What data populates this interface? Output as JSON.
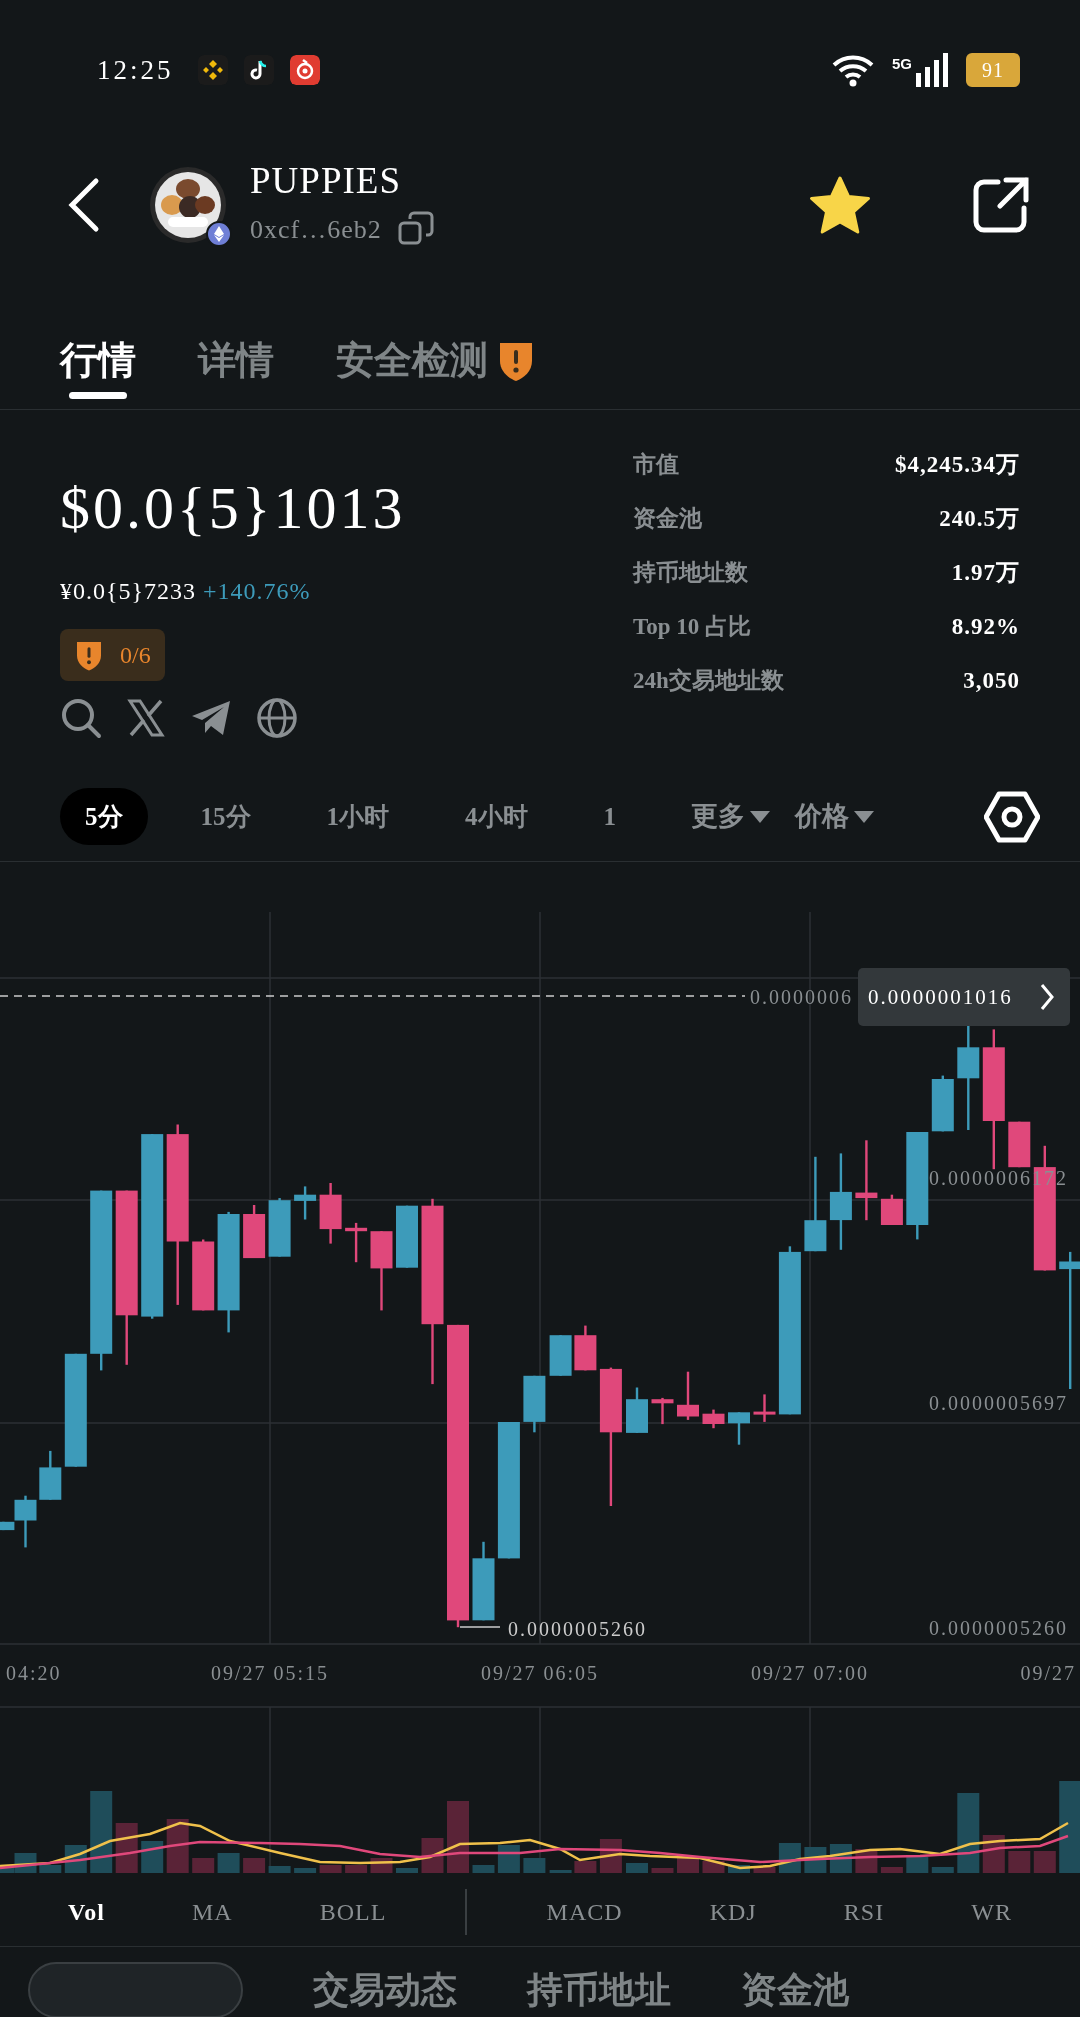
{
  "status_bar": {
    "time": "12:25",
    "network": "5G",
    "battery": "91"
  },
  "header": {
    "title": "PUPPIES",
    "address": "0xcf…6eb2",
    "favorited": true
  },
  "tabs": [
    {
      "label": "行情",
      "selected": true,
      "warning": false
    },
    {
      "label": "详情",
      "selected": false,
      "warning": false
    },
    {
      "label": "安全检测",
      "selected": false,
      "warning": true
    }
  ],
  "price": {
    "usd": "$0.0{5}1013",
    "cny": "¥0.0{5}7233",
    "change": "+140.76%",
    "risk_score": "0/6"
  },
  "stats": [
    {
      "label": "市值",
      "value": "$4,245.34万"
    },
    {
      "label": "资金池",
      "value": "240.5万"
    },
    {
      "label": "持币地址数",
      "value": "1.97万"
    },
    {
      "label": "Top 10 占比",
      "value": "8.92%"
    },
    {
      "label": "24h交易地址数",
      "value": "3,050"
    }
  ],
  "timeframes": [
    {
      "label": "5分",
      "selected": true
    },
    {
      "label": "15分",
      "selected": false
    },
    {
      "label": "1小时",
      "selected": false
    },
    {
      "label": "4小时",
      "selected": false
    },
    {
      "label": "1",
      "selected": false
    }
  ],
  "dropdowns": [
    "更多",
    "价格"
  ],
  "chart": {
    "hidden_label": "0.0000006",
    "current_price": "0.0000001016",
    "price_labels": [
      "0.0000006172",
      "0.0000005697",
      "0.0000005260"
    ],
    "low_label": "0.0000005260",
    "time_labels": [
      "04:20",
      "09/27 05:15",
      "09/27 06:05",
      "09/27 07:00",
      "09/27"
    ]
  },
  "indicator_groups": [
    {
      "items": [
        {
          "label": "Vol",
          "selected": true
        },
        {
          "label": "MA",
          "selected": false
        },
        {
          "label": "BOLL",
          "selected": false
        }
      ]
    },
    {
      "items": [
        {
          "label": "MACD",
          "selected": false
        },
        {
          "label": "KDJ",
          "selected": false
        },
        {
          "label": "RSI",
          "selected": false
        },
        {
          "label": "WR",
          "selected": false
        }
      ]
    }
  ],
  "bottom_tabs": [
    "交易动态",
    "持币地址",
    "资金池"
  ]
}
